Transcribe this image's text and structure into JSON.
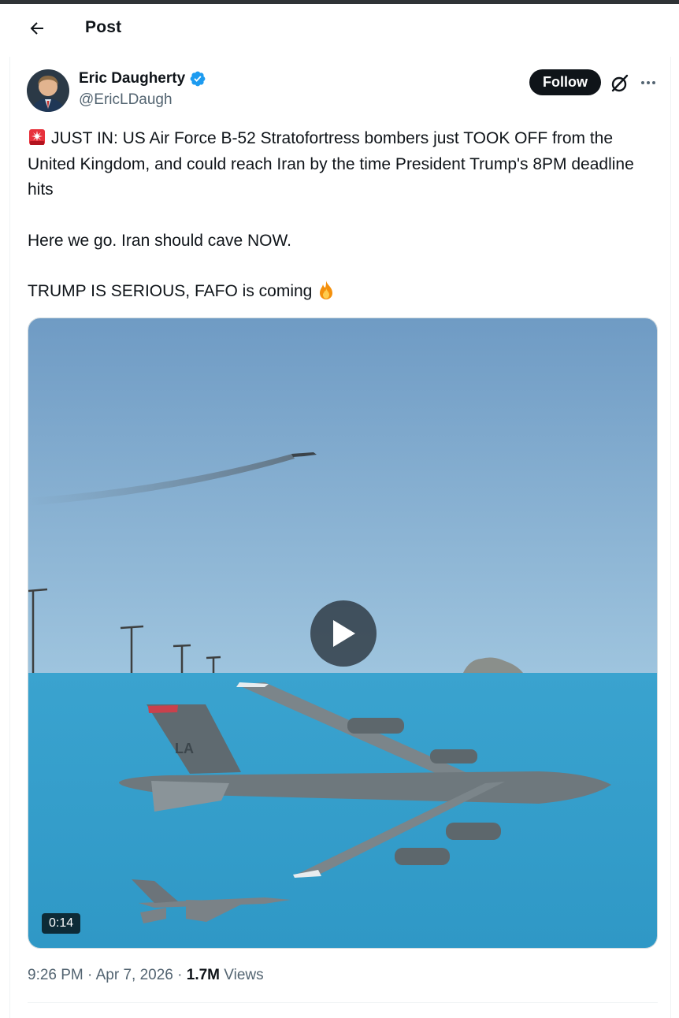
{
  "header": {
    "title": "Post"
  },
  "post": {
    "author": {
      "name": "Eric Daugherty",
      "handle": "@EricLDaugh",
      "verified": true
    },
    "follow_label": "Follow",
    "paragraphs": [
      "JUST IN: US Air Force B-52 Stratofortress bombers just TOOK OFF from the United Kingdom, and could reach Iran by the time President Trump's 8PM deadline hits",
      "Here we go. Iran should cave NOW.",
      "TRUMP IS SERIOUS, FAFO is coming"
    ],
    "media": {
      "duration": "0:14",
      "tail_code": "LA"
    },
    "time": "9:26 PM",
    "date": "Apr 7, 2026",
    "views_count": "1.7M",
    "views_label": "Views"
  },
  "colors": {
    "accent": "#1d9bf0",
    "text": "#0f1419",
    "muted": "#536471",
    "follow_bg": "#0f1419",
    "sky": "#6f9dc3",
    "sea": "#3a9fc9"
  },
  "icons": {
    "back": "arrow-left-icon",
    "verified": "verified-badge-icon",
    "grok": "grok-icon",
    "more": "more-dots-icon",
    "alert": "police-light-emoji",
    "fire": "fire-emoji",
    "play": "play-icon"
  }
}
